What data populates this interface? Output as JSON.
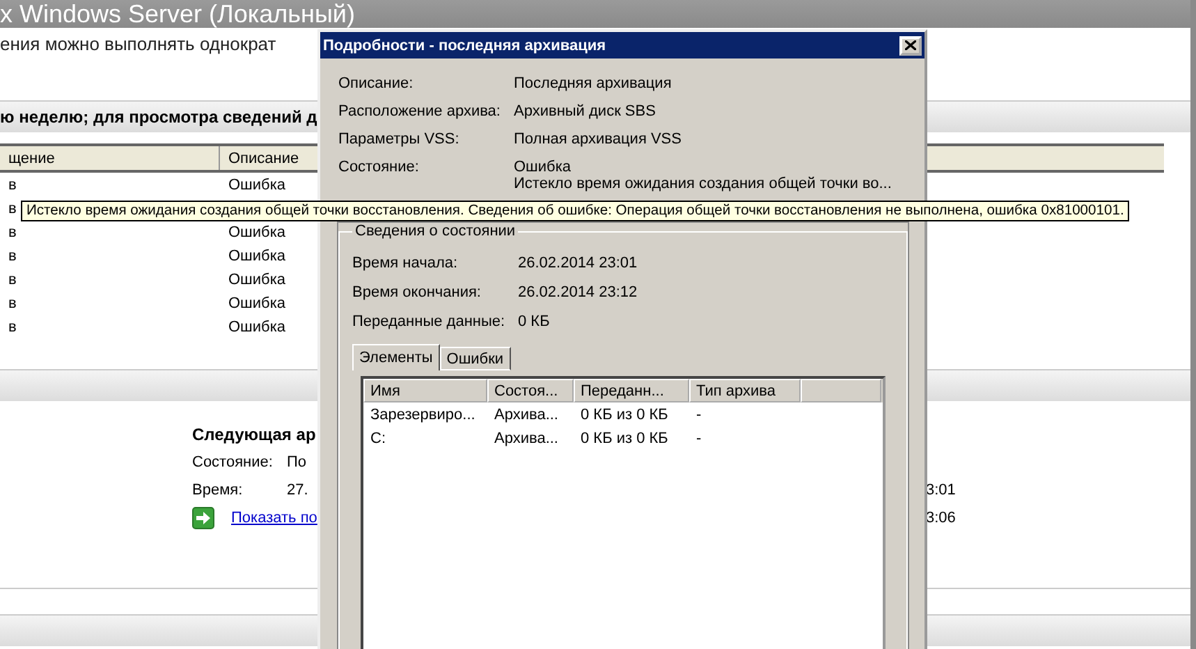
{
  "background": {
    "title": "x Windows Server (Локальный)",
    "intro": "ения можно выполнять однократ",
    "banner": "ю неделю; для просмотра сведений д",
    "table": {
      "columns": [
        "щение",
        "Описание"
      ],
      "rows": [
        {
          "cells": [
            "в",
            "Ошибка"
          ]
        },
        {
          "cells": [
            "в"
          ]
        },
        {
          "cells": [
            "в",
            "Ошибка"
          ]
        },
        {
          "cells": [
            "в",
            "Ошибка"
          ]
        },
        {
          "cells": [
            "в",
            "Ошибка"
          ]
        },
        {
          "cells": [
            "в",
            "Ошибка"
          ]
        },
        {
          "cells": [
            "в",
            "Ошибка"
          ]
        }
      ]
    },
    "next": {
      "heading": "Следующая ар",
      "fields": [
        {
          "label": "Состояние:",
          "value": "По"
        },
        {
          "label": "Время:",
          "value": "27.",
          "time": "3:01"
        }
      ],
      "link": "Показать по",
      "link_time": "3:06"
    }
  },
  "dialog": {
    "title": "Подробности - последняя архивация",
    "fields": [
      {
        "label": "Описание:",
        "value": "Последняя архивация"
      },
      {
        "label": "Расположение архива:",
        "value": "Архивный диск SBS"
      },
      {
        "label": "Параметры VSS:",
        "value": "Полная архивация VSS"
      },
      {
        "label": "Состояние:",
        "value": "Ошибка",
        "detail": "Истекло время ожидания создания общей точки во..."
      }
    ],
    "group": {
      "legend": "Сведения о состоянии",
      "fields": [
        {
          "label": "Время начала:",
          "value": "26.02.2014 23:01"
        },
        {
          "label": "Время окончания:",
          "value": "26.02.2014 23:12"
        },
        {
          "label": "Переданные данные:",
          "value": "0 КБ"
        }
      ]
    },
    "tabs": [
      {
        "label": "Элементы",
        "selected": true
      },
      {
        "label": "Ошибки",
        "selected": false
      }
    ],
    "list": {
      "columns": [
        "Имя",
        "Состоя...",
        "Переданн...",
        "Тип архива"
      ],
      "rows": [
        {
          "cells": [
            "Зарезервиро...",
            "Архива...",
            "0 КБ из 0 КБ",
            "-"
          ]
        },
        {
          "cells": [
            "C:",
            "Архива...",
            "0 КБ из 0 КБ",
            "-"
          ]
        }
      ]
    }
  },
  "tooltip": "Истекло время ожидания создания общей точки восстановления. Сведения об ошибке: Операция общей точки восстановления не выполнена, ошибка 0x81000101."
}
